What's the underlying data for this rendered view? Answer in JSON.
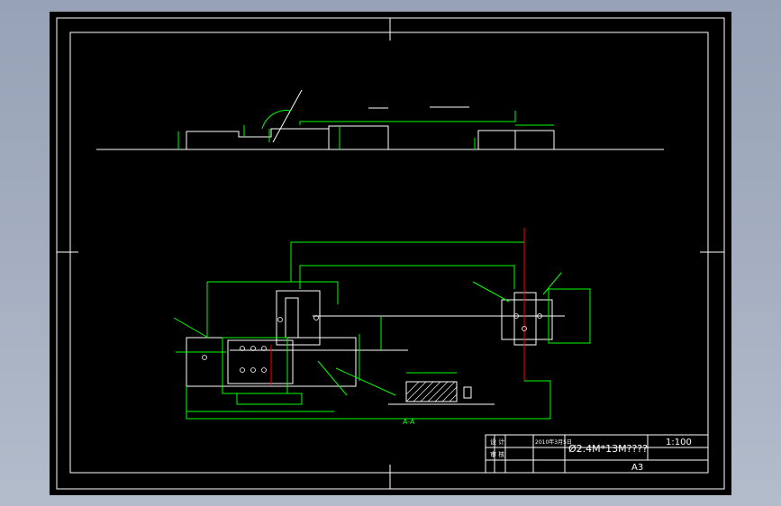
{
  "title_block": {
    "drawing_title": "Ø2.4M*13M????",
    "scale": "1:100",
    "sheet_size": "A3",
    "date": "2010年3月5日",
    "designer_label": "设 计",
    "checker_label": "审 核"
  },
  "section_label": "A-A",
  "colors": {
    "paper": "#000000",
    "border": "#ffffff",
    "geometry": "#ffffff",
    "dimension": "#00ff00",
    "centerline": "#ff0000",
    "window_bg": "#a4aec0"
  }
}
